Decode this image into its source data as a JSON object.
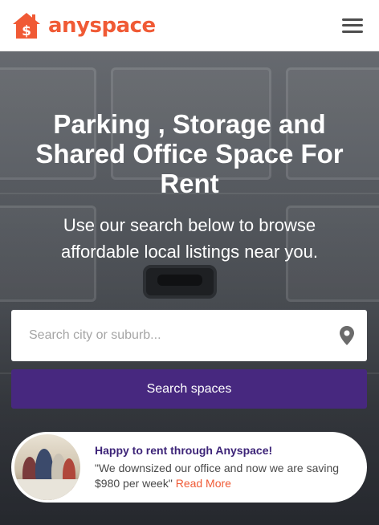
{
  "header": {
    "brand_name": "anyspace",
    "logo_icon": "house-dollar-icon",
    "menu_icon": "hamburger-menu-icon",
    "accent_color": "#f05a35"
  },
  "hero": {
    "title": "Parking , Storage and Shared Office Space For Rent",
    "subtitle": "Use our search below to browse affordable local listings near you."
  },
  "search": {
    "placeholder": "Search city or suburb...",
    "value": "",
    "location_icon": "map-pin-icon",
    "button_label": "Search spaces",
    "button_color": "#47287f"
  },
  "testimonial": {
    "title": "Happy to rent through Anyspace!",
    "quote": "\"We downsized our office and now we are saving $980 per week\"",
    "link_label": "Read More",
    "title_color": "#3d2478"
  }
}
